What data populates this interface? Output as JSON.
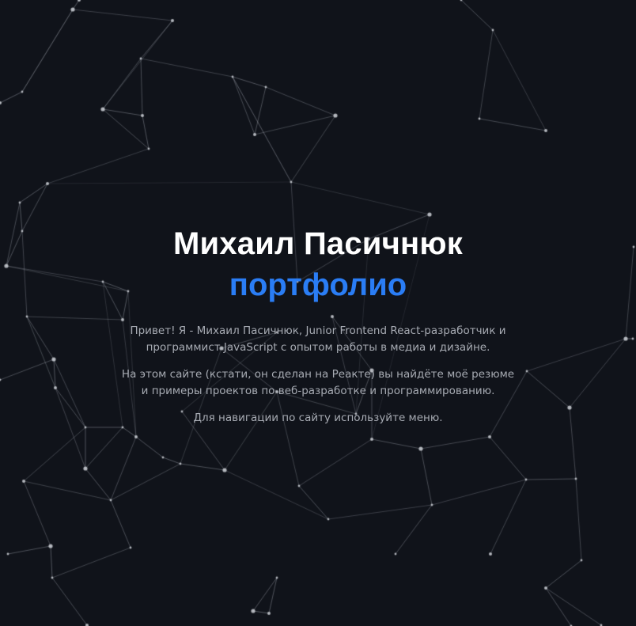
{
  "hero": {
    "name": "Михаил Пасичнюк",
    "subtitle": "портфолио",
    "intro": "Привет! Я - Михаил Пасичнюк, Junior Frontend React-разработчик и программист JavaScript с опытом работы в медиа и дизайне.",
    "about_site": "На этом сайте (кстати, он сделан на Реакте) вы найдёте моё резюме и примеры проектов по веб-разработке и программированию.",
    "nav_hint": "Для навигации по сайту используйте меню."
  },
  "colors": {
    "background": "#10131a",
    "accent": "#2a7df5",
    "title": "#ffffff",
    "body_text": "#a7abb3",
    "network_lines": "#8a8f99",
    "network_nodes": "#c9ccd2"
  }
}
